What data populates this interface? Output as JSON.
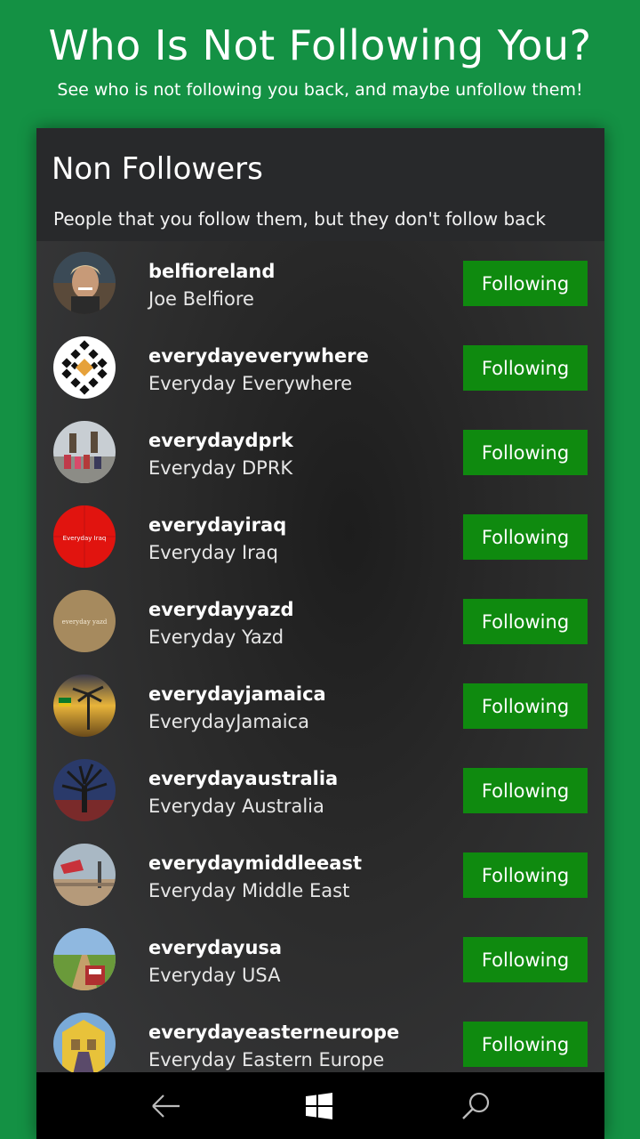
{
  "promo": {
    "title": "Who Is Not Following You?",
    "subtitle": "See who is not following you back, and maybe unfollow them!"
  },
  "header": {
    "title": "Non Followers",
    "description": "People that you follow them, but they don't follow back"
  },
  "users": [
    {
      "username": "belfioreland",
      "fullname": "Joe Belfiore",
      "button": "Following",
      "avatar": "portrait-photo"
    },
    {
      "username": "everydayeverywhere",
      "fullname": "Everyday Everywhere",
      "button": "Following",
      "avatar": "diamond-pattern-logo"
    },
    {
      "username": "everydaydprk",
      "fullname": "Everyday DPRK",
      "button": "Following",
      "avatar": "statues-photo"
    },
    {
      "username": "everydayiraq",
      "fullname": "Everyday Iraq",
      "button": "Following",
      "avatar": "red-logo",
      "avatar_text": "Everyday Iraq"
    },
    {
      "username": "everydayyazd",
      "fullname": "Everyday Yazd",
      "button": "Following",
      "avatar": "tan-logo",
      "avatar_text": "everyday yazd"
    },
    {
      "username": "everydayjamaica",
      "fullname": "EverydayJamaica",
      "button": "Following",
      "avatar": "palm-sunset-photo"
    },
    {
      "username": "everydayaustralia",
      "fullname": "Everyday Australia",
      "button": "Following",
      "avatar": "tree-photo"
    },
    {
      "username": "everydaymiddleeast",
      "fullname": "Everyday Middle East",
      "button": "Following",
      "avatar": "street-photo"
    },
    {
      "username": "everydayusa",
      "fullname": "Everyday USA",
      "button": "Following",
      "avatar": "field-photo"
    },
    {
      "username": "everydayeasterneurope",
      "fullname": "Everyday Eastern Europe",
      "button": "Following",
      "avatar": "yellow-building-photo"
    }
  ],
  "colors": {
    "background": "#149144",
    "button": "#0f8a0f",
    "header": "#28292b",
    "navbar": "#000000"
  },
  "navbar": {
    "icons": [
      "back-arrow-icon",
      "windows-logo-icon",
      "search-icon"
    ]
  }
}
